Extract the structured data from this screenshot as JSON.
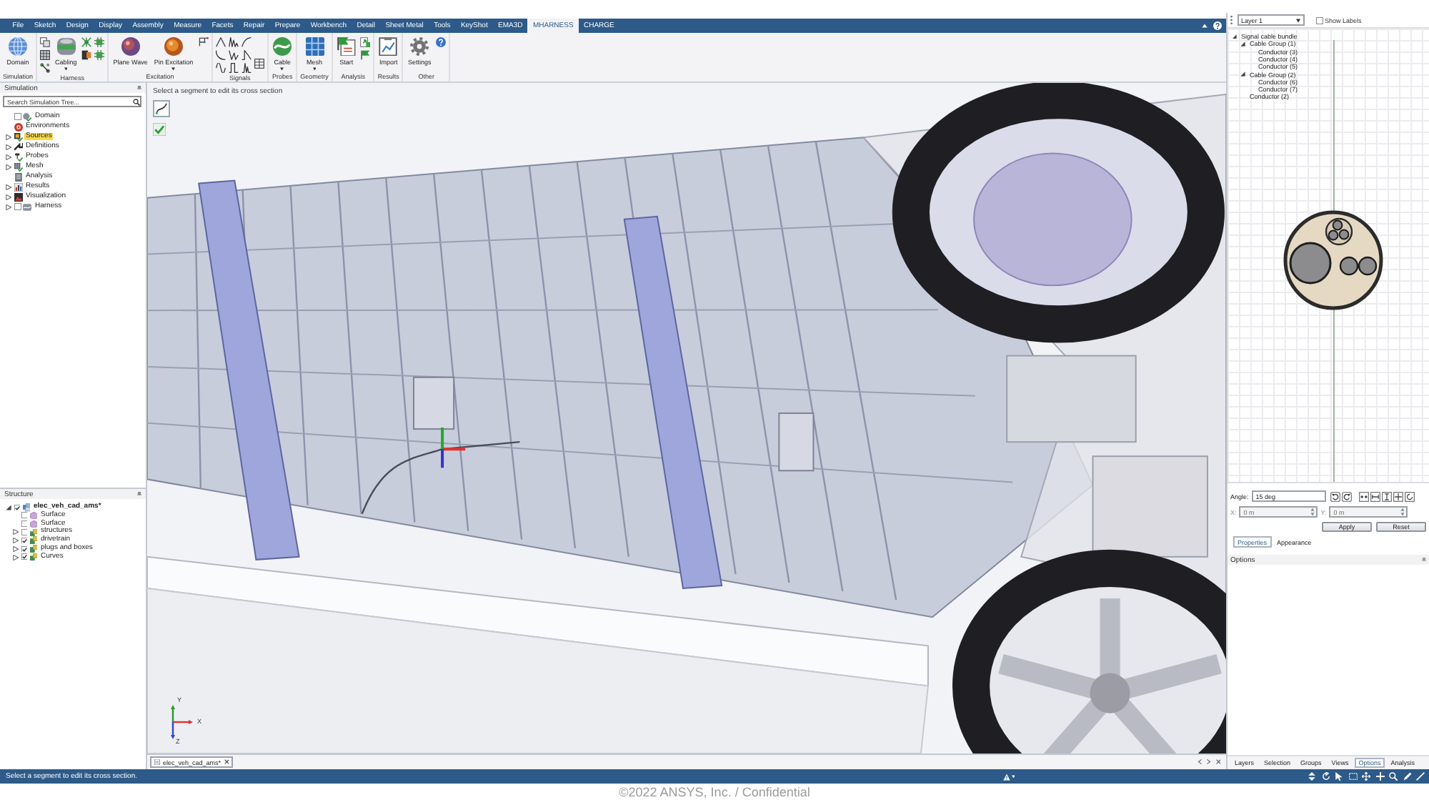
{
  "menu_tabs": [
    {
      "label": "File",
      "selected": false
    },
    {
      "label": "Sketch",
      "selected": false
    },
    {
      "label": "Design",
      "selected": false
    },
    {
      "label": "Display",
      "selected": false
    },
    {
      "label": "Assembly",
      "selected": false
    },
    {
      "label": "Measure",
      "selected": false
    },
    {
      "label": "Facets",
      "selected": false
    },
    {
      "label": "Repair",
      "selected": false
    },
    {
      "label": "Prepare",
      "selected": false
    },
    {
      "label": "Workbench",
      "selected": false
    },
    {
      "label": "Detail",
      "selected": false
    },
    {
      "label": "Sheet Metal",
      "selected": false
    },
    {
      "label": "Tools",
      "selected": false
    },
    {
      "label": "KeyShot",
      "selected": false
    },
    {
      "label": "EMA3D",
      "selected": false
    },
    {
      "label": "MHARNESS",
      "selected": true
    },
    {
      "label": "CHARGE",
      "selected": false
    }
  ],
  "ribbon_groups": [
    {
      "label": "Simulation",
      "tools": [
        {
          "label": "Domain",
          "dropdown": false
        }
      ]
    },
    {
      "label": "Harness",
      "tools": [
        {
          "label": "Cabling",
          "dropdown": true
        }
      ]
    },
    {
      "label": "Excitation",
      "tools": [
        {
          "label": "Plane Wave",
          "dropdown": false
        },
        {
          "label": "Pin Excitation",
          "dropdown": true
        }
      ]
    },
    {
      "label": "Signals"
    },
    {
      "label": "Probes",
      "tools": [
        {
          "label": "Cable",
          "dropdown": true
        }
      ]
    },
    {
      "label": "Geometry",
      "tools": [
        {
          "label": "Mesh",
          "dropdown": true
        }
      ]
    },
    {
      "label": "Analysis",
      "tools": [
        {
          "label": "Start",
          "dropdown": false
        }
      ]
    },
    {
      "label": "Results",
      "tools": [
        {
          "label": "Import",
          "dropdown": false
        }
      ]
    },
    {
      "label": "Other",
      "tools": [
        {
          "label": "Settings",
          "dropdown": false
        }
      ]
    }
  ],
  "simulation_panel": {
    "title": "Simulation",
    "search": {
      "placeholder": "Search Simulation Tree..."
    },
    "items": [
      {
        "label": "Domain",
        "kind": "checkbox",
        "checked": false,
        "selected": false
      },
      {
        "label": "Environments",
        "kind": "plain",
        "selected": false
      },
      {
        "label": "Sources",
        "kind": "plain",
        "expanded": false,
        "selected": true
      },
      {
        "label": "Definitions",
        "kind": "plain",
        "expanded": false,
        "selected": false
      },
      {
        "label": "Probes",
        "kind": "plain",
        "expanded": false,
        "selected": false
      },
      {
        "label": "Mesh",
        "kind": "plain",
        "expanded": false,
        "selected": false
      },
      {
        "label": "Analysis",
        "kind": "plain",
        "selected": false
      },
      {
        "label": "Results",
        "kind": "plain",
        "expanded": false,
        "selected": false
      },
      {
        "label": "Visualization",
        "kind": "plain",
        "expanded": false,
        "selected": false
      },
      {
        "label": "Harness",
        "kind": "checkbox",
        "checked": false,
        "expanded": false,
        "selected": false
      }
    ]
  },
  "structure_panel": {
    "title": "Structure",
    "items": [
      {
        "label": "elec_veh_cad_ams*",
        "checked": true,
        "expanded": true,
        "children": [
          {
            "label": "Surface",
            "checked": false
          },
          {
            "label": "Surface",
            "checked": false
          },
          {
            "label": "structures",
            "checked": false,
            "expanded": false
          },
          {
            "label": "drivetrain",
            "checked": true,
            "expanded": false
          },
          {
            "label": "plugs and boxes",
            "checked": true,
            "expanded": false
          },
          {
            "label": "Curves",
            "checked": true,
            "expanded": false
          }
        ]
      }
    ]
  },
  "viewport": {
    "hint": "Select a segment to edit its cross section",
    "axes": [
      "Y",
      "X",
      "Z"
    ]
  },
  "document_tabs": [
    {
      "label": "elec_veh_cad_ams*",
      "selected": true
    }
  ],
  "layer_bar": {
    "layer": "Layer 1",
    "show_labels": {
      "label": "Show Labels",
      "checked": false
    }
  },
  "cable_tree": [
    {
      "label": "Signal cable bundle",
      "expanded": true,
      "children": [
        {
          "label": "Cable Group (1)",
          "expanded": true,
          "children": [
            {
              "label": "Conductor (3)"
            },
            {
              "label": "Conductor (4)"
            },
            {
              "label": "Conductor (5)"
            }
          ]
        },
        {
          "label": "Cable Group (2)",
          "expanded": true,
          "children": [
            {
              "label": "Conductor (6)"
            },
            {
              "label": "Conductor (7)"
            }
          ]
        },
        {
          "label": "Conductor (2)"
        }
      ]
    }
  ],
  "section_editor": {
    "angle": {
      "label": "Angle:",
      "value": "15 deg"
    },
    "offsets": [
      {
        "label": "X:",
        "value": "0 m",
        "disabled": true
      },
      {
        "label": "Y:",
        "value": "0 m",
        "disabled": true
      }
    ],
    "buttons": [
      "Apply",
      "Reset"
    ]
  },
  "property_tabs": [
    {
      "label": "Properties",
      "selected": true
    },
    {
      "label": "Appearance",
      "selected": false
    }
  ],
  "options_header": "Options",
  "panel_tabs": [
    {
      "label": "Layers",
      "selected": false
    },
    {
      "label": "Selection",
      "selected": false
    },
    {
      "label": "Groups",
      "selected": false
    },
    {
      "label": "Views",
      "selected": false
    },
    {
      "label": "Options",
      "selected": true
    },
    {
      "label": "Analysis",
      "selected": false
    }
  ],
  "status_bar": {
    "message": "Select a segment to edit its cross section."
  },
  "footer": "©2022 ANSYS, Inc. / Confidential"
}
